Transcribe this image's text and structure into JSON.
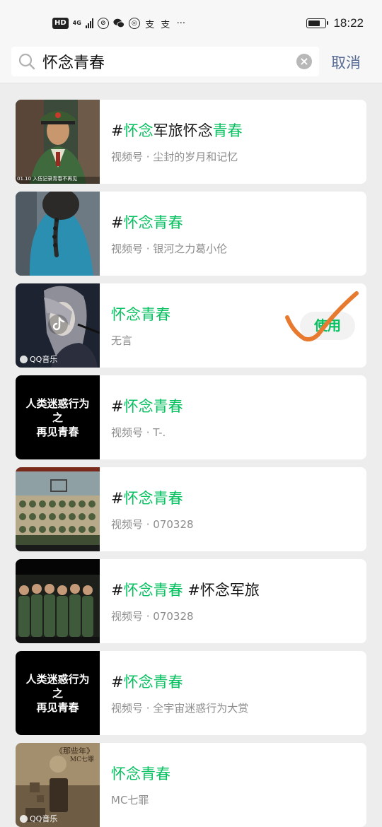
{
  "status_bar": {
    "badge": "HD",
    "network": "4G",
    "icons": [
      "hd-badge",
      "signal-icon",
      "vpn-icon",
      "wechat-icon",
      "app-icon",
      "alipay-icon",
      "alipay-icon",
      "more-icon"
    ],
    "app_glyph_1": "支",
    "app_glyph_2": "支",
    "more": "···",
    "battery_level": 0.75,
    "time": "18:22"
  },
  "search": {
    "value": "怀念青春",
    "clear_icon": "×",
    "cancel_label": "取消"
  },
  "colors": {
    "highlight": "#07c160",
    "link": "#576b95",
    "checkmark": "#e77a2e"
  },
  "results": [
    {
      "title_prefix": "#",
      "title_hl": "怀念",
      "title_mid": "军旅怀念",
      "title_hl2": "青春",
      "title_suffix": "",
      "subtitle": "视频号 · 尘封的岁月和记忆",
      "thumb_caption": "01.10 入伍记录青春不再见"
    },
    {
      "title_prefix": "#",
      "title_hl": "怀念青春",
      "title_mid": "",
      "title_hl2": "",
      "title_suffix": "",
      "subtitle": "视频号 · 银河之力葛小伦"
    },
    {
      "title_prefix": "",
      "title_hl": "怀念青春",
      "title_mid": "",
      "title_hl2": "",
      "title_suffix": "",
      "subtitle": "无言",
      "source": "QQ音乐",
      "use_label": "使用",
      "selected": true
    },
    {
      "title_prefix": "#",
      "title_hl": "怀念青春",
      "title_mid": "",
      "title_hl2": "",
      "title_suffix": "",
      "subtitle": "视频号 · T-.",
      "thumb_lines": [
        "人类迷惑行为",
        "之",
        "再见青春"
      ]
    },
    {
      "title_prefix": "#",
      "title_hl": "怀念青春",
      "title_mid": "",
      "title_hl2": "",
      "title_suffix": "",
      "subtitle": "视频号 · 070328"
    },
    {
      "title_prefix": "#",
      "title_hl": "怀念青春",
      "title_mid": "",
      "title_hl2": "",
      "title_suffix": " #怀念军旅",
      "subtitle": "视频号 · 070328"
    },
    {
      "title_prefix": "#",
      "title_hl": "怀念青春",
      "title_mid": "",
      "title_hl2": "",
      "title_suffix": "",
      "subtitle": "视频号 · 全宇宙迷惑行为大赏",
      "thumb_lines": [
        "人类迷惑行为",
        "之",
        "再见青春"
      ]
    },
    {
      "title_prefix": "",
      "title_hl": "怀念青春",
      "title_mid": "",
      "title_hl2": "",
      "title_suffix": "",
      "subtitle": "MC七罪",
      "source": "QQ音乐",
      "poster_title": "《那些年》",
      "poster_sub": "MC七罪"
    }
  ]
}
